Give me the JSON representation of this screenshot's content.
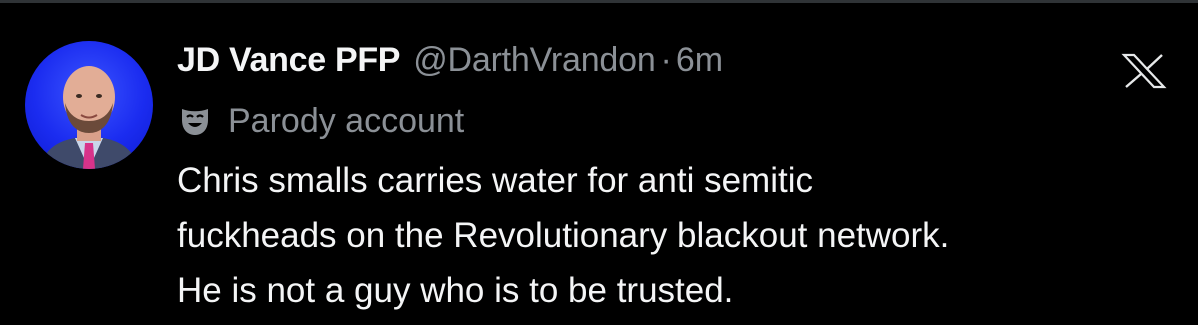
{
  "tweet": {
    "display_name": "JD Vance PFP",
    "handle": "@DarthVrandon",
    "separator": "·",
    "timestamp": "6m",
    "account_label": "Parody account",
    "account_label_icon": "theater-mask-icon",
    "avatar_icon": "profile-photo",
    "platform_logo": "x-logo-icon",
    "text_lines": [
      "Chris smalls carries water for anti semitic",
      "fuckheads on the Revolutionary blackout network.",
      "He is not a guy who is to be trusted."
    ]
  },
  "colors": {
    "background": "#000000",
    "primary_text": "#f4f5f6",
    "secondary_text": "#8b9096",
    "avatar_background": "#1b2cf0"
  }
}
